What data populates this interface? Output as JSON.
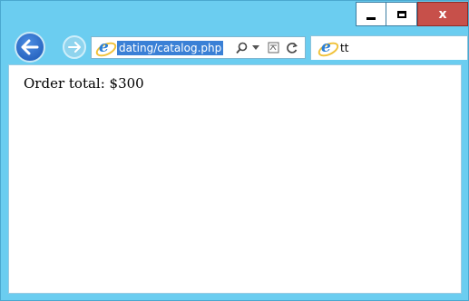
{
  "window": {
    "controls": {
      "minimize_icon": "minimize-icon",
      "maximize_icon": "maximize-icon",
      "close_label": "x"
    }
  },
  "navigation": {
    "back_icon": "back-arrow-icon",
    "forward_icon": "forward-arrow-icon"
  },
  "address_bar": {
    "url": "dating/catalog.php",
    "site_icon": "ie-logo-icon",
    "search_icon": "search-icon",
    "dropdown_icon": "dropdown-arrow-icon",
    "compat_icon": "compatibility-view-icon",
    "refresh_icon": "refresh-icon"
  },
  "tab": {
    "title": "tt",
    "icon": "ie-logo-icon"
  },
  "page": {
    "order_total": "Order total: $300"
  },
  "colors": {
    "frame": "#6bcdf0",
    "close_button": "#c7504a",
    "selection": "#3a80d6"
  }
}
